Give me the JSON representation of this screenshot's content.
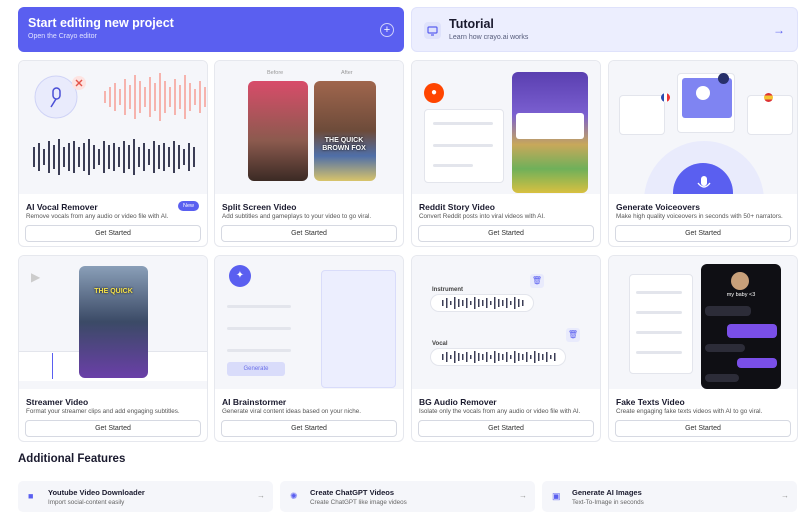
{
  "hero": {
    "primary": {
      "title": "Start editing new project",
      "subtitle": "Open the Crayo editor"
    },
    "secondary": {
      "title": "Tutorial",
      "subtitle": "Learn how crayo.ai works"
    }
  },
  "cards": [
    {
      "title": "AI Vocal Remover",
      "desc": "Remove vocals from any audio or video file with AI.",
      "button": "Get Started",
      "badge": "New"
    },
    {
      "title": "Split Screen Video",
      "desc": "Add subtitles and gameplays to your video to go viral.",
      "button": "Get Started",
      "before": "Before",
      "after": "After",
      "overlay": "THE QUICK BROWN FOX"
    },
    {
      "title": "Reddit Story Video",
      "desc": "Convert Reddit posts into viral videos with AI.",
      "button": "Get Started"
    },
    {
      "title": "Generate Voiceovers",
      "desc": "Make high quality voiceovers in seconds with 50+ narrators.",
      "button": "Get Started"
    },
    {
      "title": "Streamer Video",
      "desc": "Format your streamer clips and add engaging subtitles.",
      "button": "Get Started",
      "overlay": "THE QUICK"
    },
    {
      "title": "AI Brainstormer",
      "desc": "Generate viral content ideas based on your niche.",
      "button": "Get Started",
      "generate": "Generate"
    },
    {
      "title": "BG Audio Remover",
      "desc": "Isolate only the vocals from any audio or video file with AI.",
      "button": "Get Started",
      "instrument": "Instrument",
      "vocal": "Vocal"
    },
    {
      "title": "Fake Texts Video",
      "desc": "Create engaging fake texts videos with AI to go viral.",
      "button": "Get Started",
      "contact": "my baby <3"
    }
  ],
  "additional": {
    "title": "Additional Features",
    "items": [
      {
        "title": "Youtube Video Downloader",
        "desc": "Import social-content easily",
        "icon": "video-camera-icon"
      },
      {
        "title": "Create ChatGPT Videos",
        "desc": "Create ChatGPT like image videos",
        "icon": "chatgpt-icon"
      },
      {
        "title": "Generate AI Images",
        "desc": "Text-To-Image in seconds",
        "icon": "image-icon"
      }
    ]
  },
  "colors": {
    "accent": "#5a5ff0",
    "accent_light": "#eceefe"
  }
}
